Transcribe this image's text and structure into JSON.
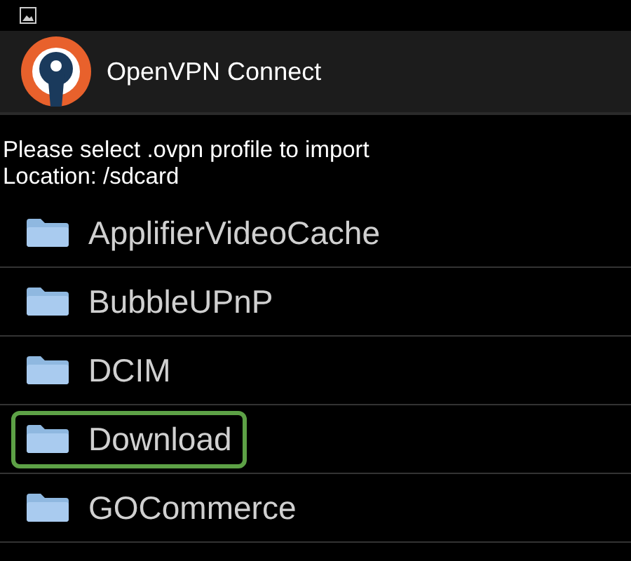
{
  "action_bar": {
    "title": "OpenVPN Connect"
  },
  "prompt": "Please select .ovpn profile to import",
  "location": "Location: /sdcard",
  "folders": [
    {
      "name": "ApplifierVideoCache",
      "highlighted": false
    },
    {
      "name": "BubbleUPnP",
      "highlighted": false
    },
    {
      "name": "DCIM",
      "highlighted": false
    },
    {
      "name": "Download",
      "highlighted": true
    },
    {
      "name": "GOCommerce",
      "highlighted": false
    }
  ]
}
